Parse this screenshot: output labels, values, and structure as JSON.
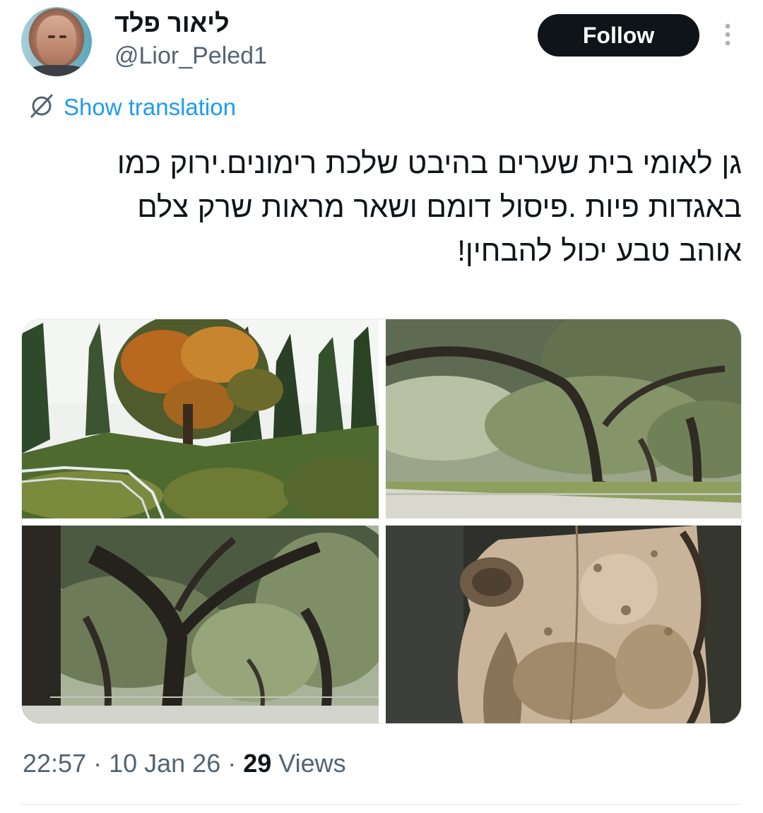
{
  "author": {
    "display_name": "ליאור פלד",
    "handle": "@Lior_Peled1",
    "avatar_icon": "profile-avatar"
  },
  "actions": {
    "follow_label": "Follow",
    "more_icon": "more-vertical-icon"
  },
  "translation": {
    "icon": "globe-translate-icon",
    "label": "Show translation"
  },
  "tweet": {
    "text": "גן לאומי בית שערים בהיבט שלכת רימונים.ירוק  כמו\nבאגדות פיות .פיסול דומם ושאר מראות שרק צלם\nאוהב טבע יכול להבחין!"
  },
  "media": [
    {
      "subject": "hillside-with-autumn-tree-and-cypresses"
    },
    {
      "subject": "oak-grove-with-path"
    },
    {
      "subject": "large-oak-trees-in-park"
    },
    {
      "subject": "gnarled-tree-trunk-closeup"
    }
  ],
  "meta": {
    "time": "22:57",
    "separator": " · ",
    "date": "10 Jan 26",
    "views_count": "29",
    "views_label": " Views"
  },
  "colors": {
    "text": "#0f1419",
    "secondary": "#536471",
    "link": "#1d9bf0",
    "button_bg": "#0f1419",
    "button_text": "#ffffff"
  }
}
